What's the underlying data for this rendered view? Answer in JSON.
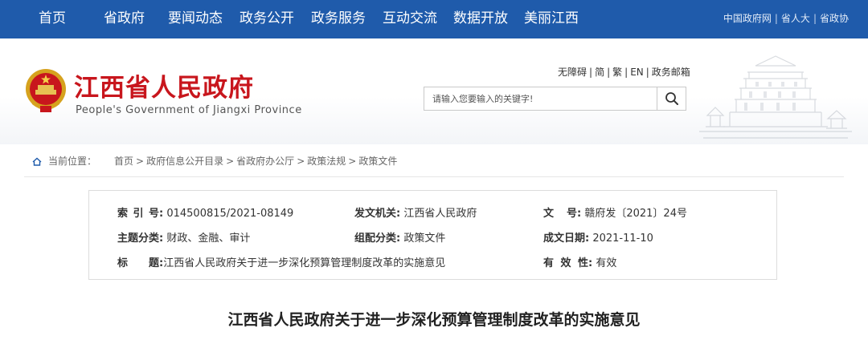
{
  "nav": {
    "items": [
      "首页",
      "省政府",
      "要闻动态",
      "政务公开",
      "政务服务",
      "互动交流",
      "数据开放",
      "美丽江西"
    ],
    "right_links": [
      "中国政府网",
      "省人大",
      "省政协"
    ],
    "bg_color": "#1f5bab"
  },
  "header": {
    "site_name": "江西省人民政府",
    "site_name_en": "People's Government of Jiangxi Province",
    "brand_color": "#c8161d",
    "util_links": [
      "无障碍",
      "简",
      "繁",
      "EN",
      "政务邮箱"
    ],
    "search": {
      "placeholder": "请输入您要输入的关键字!",
      "button_icon": "search-icon"
    }
  },
  "breadcrumb": {
    "label": "当前位置：",
    "items": [
      "首页",
      "政府信息公开目录",
      "省政府办公厅",
      "政策法规",
      "政策文件"
    ],
    "icon": "home-icon"
  },
  "info": {
    "index_no": {
      "key": "索引号",
      "value": "014500815/2021-08149"
    },
    "issuer": {
      "key": "发文机关:",
      "value": "江西省人民政府"
    },
    "doc_no": {
      "key": "文号",
      "value": "赣府发〔2021〕24号"
    },
    "category": {
      "key": "主题分类:",
      "value": "财政、金融、审计"
    },
    "group": {
      "key": "组配分类:",
      "value": "政策文件"
    },
    "date": {
      "key": "成文日期:",
      "value": "2021-11-10"
    },
    "title": {
      "key": "标题",
      "value": "江西省人民政府关于进一步深化预算管理制度改革的实施意见"
    },
    "validity": {
      "key": "有效性",
      "value": "有效"
    }
  },
  "article": {
    "title": "江西省人民政府关于进一步深化预算管理制度改革的实施意见"
  }
}
